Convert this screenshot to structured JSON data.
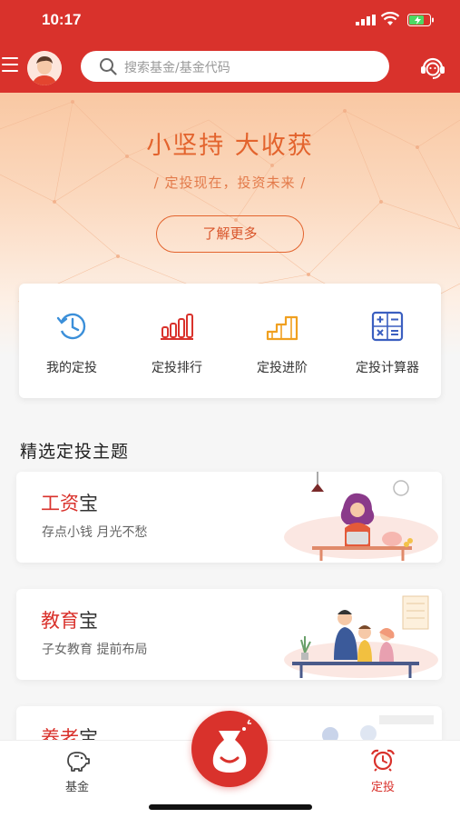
{
  "status": {
    "time": "10:17"
  },
  "search": {
    "placeholder": "搜索基金/基金代码"
  },
  "banner": {
    "title": "小坚持 大收获",
    "subtitle": "/ 定投现在，投资未来 /",
    "button": "了解更多"
  },
  "quick_menu": [
    {
      "label": "我的定投",
      "icon": "clock-icon"
    },
    {
      "label": "定投排行",
      "icon": "bar-chart-icon"
    },
    {
      "label": "定投进阶",
      "icon": "stairs-icon"
    },
    {
      "label": "定投计算器",
      "icon": "calculator-icon"
    }
  ],
  "section_title": "精选定投主题",
  "themes": [
    {
      "name_highlight": "工资",
      "name_rest": "宝",
      "desc": "存点小钱 月光不愁"
    },
    {
      "name_highlight": "教育",
      "name_rest": "宝",
      "desc": "子女教育 提前布局"
    },
    {
      "name_highlight": "养老",
      "name_rest": "宝",
      "desc": ""
    }
  ],
  "tabs": [
    {
      "label": "基金",
      "icon": "piggy-bank-icon",
      "active": false
    },
    {
      "label": "定投",
      "icon": "alarm-clock-icon",
      "active": true
    }
  ],
  "colors": {
    "brand": "#d9322c",
    "accent": "#e3632d"
  }
}
